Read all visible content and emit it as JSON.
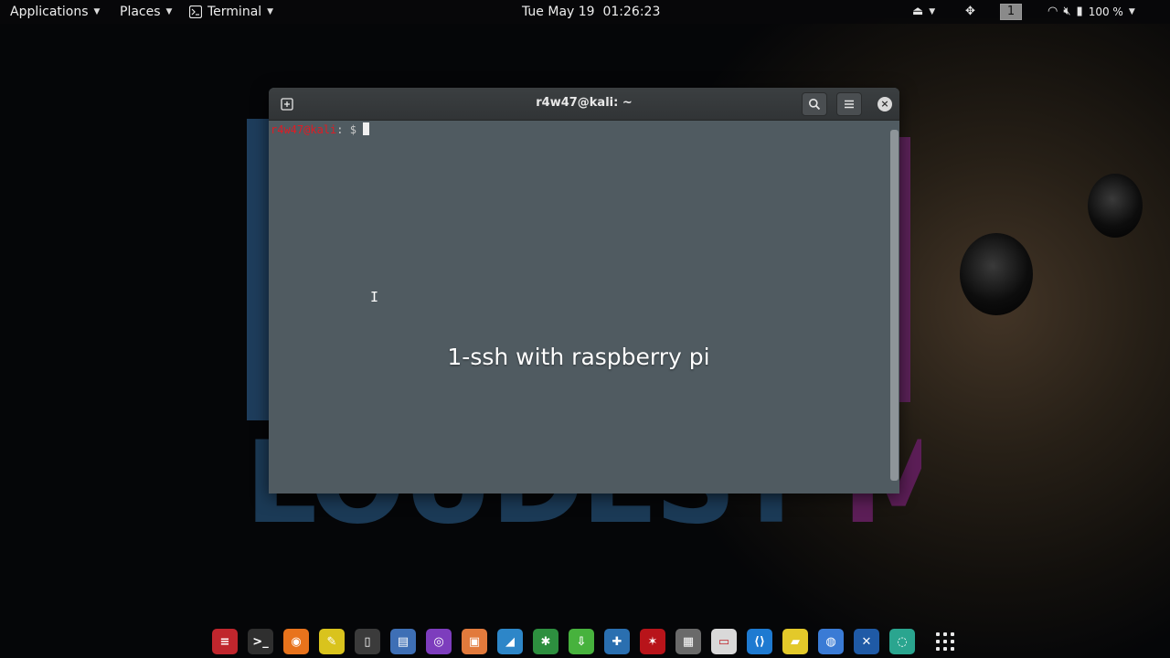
{
  "top_panel": {
    "applications_label": "Applications",
    "places_label": "Places",
    "terminal_label": "Terminal",
    "clock": "Tue May 19  01:26:23",
    "workspace_number": "1",
    "battery_percent": "100 %"
  },
  "terminal": {
    "title": "r4w47@kali: ~",
    "prompt_user": "r4w47@kali",
    "prompt_suffix": ": $ ",
    "caption": "1-ssh with raspberry pi"
  },
  "dock": {
    "apps": [
      {
        "name": "kali-tools-icon",
        "glyph": "≡",
        "color": "#c0262d"
      },
      {
        "name": "terminal-icon",
        "glyph": ">_",
        "color": "#2f2f2f"
      },
      {
        "name": "firefox-icon",
        "glyph": "◉",
        "color": "#e8731c"
      },
      {
        "name": "text-editor-icon",
        "glyph": "✎",
        "color": "#d9c31d"
      },
      {
        "name": "notes-icon",
        "glyph": "▯",
        "color": "#3b3b3b"
      },
      {
        "name": "file-manager-icon",
        "glyph": "▤",
        "color": "#3e6fb5"
      },
      {
        "name": "tor-browser-icon",
        "glyph": "◎",
        "color": "#7d3dbd"
      },
      {
        "name": "burpsuite-icon",
        "glyph": "▣",
        "color": "#e27a3c"
      },
      {
        "name": "wireshark-icon",
        "glyph": "◢",
        "color": "#2d86c8"
      },
      {
        "name": "chromium-app-icon",
        "glyph": "✱",
        "color": "#2d8f3f"
      },
      {
        "name": "software-center-icon",
        "glyph": "⇩",
        "color": "#47b23d"
      },
      {
        "name": "network-tool-icon",
        "glyph": "✚",
        "color": "#2a6fb0"
      },
      {
        "name": "armitage-icon",
        "glyph": "✶",
        "color": "#b8141a"
      },
      {
        "name": "screenshot-icon",
        "glyph": "▦",
        "color": "#6a6a6a"
      },
      {
        "name": "document-viewer-icon",
        "glyph": "▭",
        "color": "#d9d9d9"
      },
      {
        "name": "vscode-icon",
        "glyph": "⟨⟩",
        "color": "#1e7ad1"
      },
      {
        "name": "sticky-notes-icon",
        "glyph": "▰",
        "color": "#e3c92a"
      },
      {
        "name": "chrome-icon",
        "glyph": "◍",
        "color": "#3a7bd5"
      },
      {
        "name": "dragon-tool-icon",
        "glyph": "✕",
        "color": "#1f5aa6"
      },
      {
        "name": "remote-access-icon",
        "glyph": "◌",
        "color": "#2aa58f"
      }
    ]
  }
}
